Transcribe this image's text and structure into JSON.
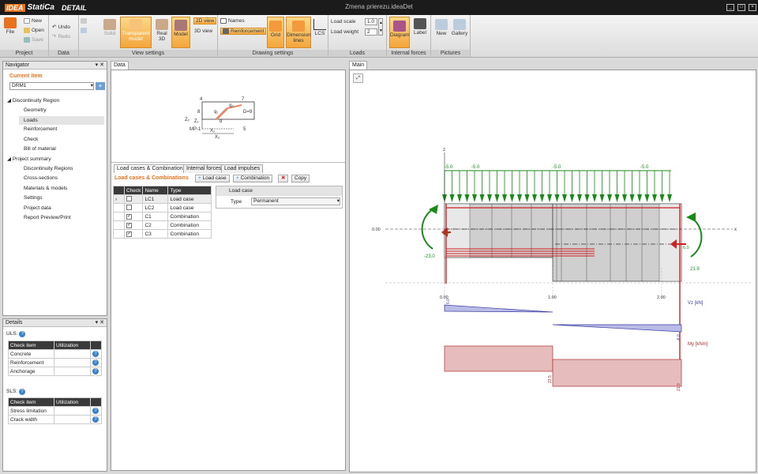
{
  "app": {
    "logo_a": "IDEA",
    "logo_b": "StatiCa",
    "logo_c": "DETAIL",
    "window_title": "Zmena prierezu.ideaDet",
    "min": "_",
    "max": "□",
    "close": "×"
  },
  "ribbon": {
    "project": {
      "label": "Project",
      "file": "File",
      "new": "New",
      "open": "Open",
      "save": "Save"
    },
    "data": {
      "label": "Data",
      "undo": "Undo",
      "redo": "Redo"
    },
    "view": {
      "label": "View settings",
      "solid": "Solid",
      "transparent": "Transparent model",
      "real3d": "Real 3D",
      "model": "Model",
      "view2d": "2D view",
      "view3d": "3D view"
    },
    "drawing": {
      "label": "Drawing settings",
      "names": "Names",
      "reinforcement": "Reinforcement",
      "grid": "Grid",
      "dimension": "Dimension lines",
      "lcs": "LCS"
    },
    "loads": {
      "label": "Loads",
      "scale_label": "Load scale",
      "scale_value": "1.0",
      "weight_label": "Load weight",
      "weight_value": "2"
    },
    "forces": {
      "label": "Internal forces",
      "diagram": "Diagram",
      "labelbtn": "Label"
    },
    "pictures": {
      "label": "Pictures",
      "new": "New",
      "gallery": "Gallery"
    }
  },
  "navigator": {
    "title": "Navigator",
    "current": "Current item",
    "selected": "DRM1",
    "items": [
      "Discontinuity Region",
      "Geometry",
      "Loads",
      "Reinforcement",
      "Check",
      "Bill of material",
      "Project summary",
      "Discontinuity Regions",
      "Cross-sections",
      "Materials & models",
      "Settings",
      "Project data",
      "Report Preview/Print"
    ]
  },
  "details": {
    "title": "Details",
    "uls": "ULS:",
    "sls": "SLS:",
    "col_item": "Check item",
    "col_util": "Utilization",
    "uls_rows": [
      "Concrete",
      "Reinforcement",
      "Anchorage"
    ],
    "sls_rows": [
      "Stress limitation",
      "Crack width"
    ]
  },
  "datapanel": {
    "tab": "Data",
    "tabs": [
      "Load cases & Combinations",
      "Internal forces",
      "Load impulses"
    ],
    "heading": "Load cases & Combinations",
    "btn_loadcase": "Load case",
    "btn_comb": "Combination",
    "btn_copy": "Copy",
    "cols": [
      "Check",
      "Name",
      "Type"
    ],
    "rows": [
      {
        "check": "",
        "name": "LC1",
        "type": "Load case"
      },
      {
        "check": "",
        "name": "LC2",
        "type": "Load case"
      },
      {
        "check": "✓",
        "name": "C1",
        "type": "Combination"
      },
      {
        "check": "✓",
        "name": "C2",
        "type": "Combination"
      },
      {
        "check": "✓",
        "name": "C3",
        "type": "Combination"
      }
    ],
    "prop_title": "Load case",
    "prop_type": "Type",
    "prop_value": "Permanent",
    "sketch": {
      "n4": "4",
      "n7": "7",
      "q2": "q₂",
      "n8": "8",
      "q1": "q₁",
      "d9": "D=9",
      "alpha": "α",
      "z2": "Z₂",
      "z1": "Z₁",
      "mp": "MP-1",
      "n5": "5",
      "x1": "X₁",
      "x2": "X₂"
    }
  },
  "main": {
    "tab": "Main",
    "load_labels": [
      "-5.0",
      "-5.0",
      "-5.0",
      "-5.0"
    ],
    "z": "z",
    "x": "x",
    "origin": "0.00",
    "m_left": "-23.0",
    "m_right": "21.9",
    "v_left": "2.9",
    "v_right": "6.0",
    "ticks": [
      "0.00",
      "1.00",
      "2.00"
    ],
    "vz": "Vz [kN]",
    "my": "My [kNm]",
    "v_l": "6.0",
    "v_r": "-6.0",
    "my_mid": "23.5",
    "my_r": "21.9",
    "my_end": "21.9"
  }
}
